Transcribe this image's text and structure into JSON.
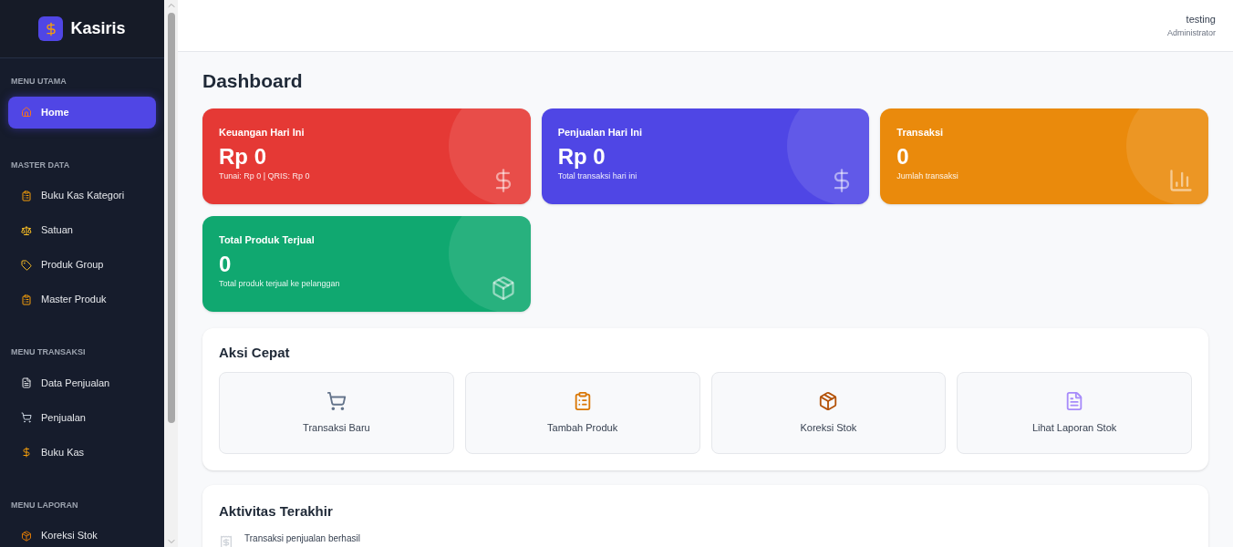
{
  "brand": {
    "name": "Kasiris"
  },
  "sidebar": {
    "sections": [
      {
        "title": "MENU UTAMA",
        "items": [
          {
            "label": "Home",
            "selected": true
          }
        ]
      },
      {
        "title": "MASTER DATA",
        "items": [
          {
            "label": "Buku Kas Kategori",
            "selected": false
          },
          {
            "label": "Satuan",
            "selected": false
          },
          {
            "label": "Produk Group",
            "selected": false
          },
          {
            "label": "Master Produk",
            "selected": false
          }
        ]
      },
      {
        "title": "MENU TRANSAKSI",
        "items": [
          {
            "label": "Data Penjualan",
            "selected": false
          },
          {
            "label": "Penjualan",
            "selected": false
          },
          {
            "label": "Buku Kas",
            "selected": false
          }
        ]
      },
      {
        "title": "MENU LAPORAN",
        "items": [
          {
            "label": "Koreksi Stok",
            "selected": false
          }
        ]
      }
    ]
  },
  "header": {
    "user_name": "testing",
    "user_role": "Administrator"
  },
  "page_title": "Dashboard",
  "stats": [
    {
      "title": "Keuangan Hari Ini",
      "value": "Rp 0",
      "caption": "Tunai: Rp 0 | QRIS: Rp 0",
      "color": "#e53935"
    },
    {
      "title": "Penjualan Hari Ini",
      "value": "Rp 0",
      "caption": "Total transaksi hari ini",
      "color": "#4f46e5"
    },
    {
      "title": "Transaksi",
      "value": "0",
      "caption": "Jumlah transaksi",
      "color": "#ea8a0c"
    },
    {
      "title": "Total Produk Terjual",
      "value": "0",
      "caption": "Total produk terjual ke pelanggan",
      "color": "#10a870"
    }
  ],
  "quick_actions": {
    "title": "Aksi Cepat",
    "items": [
      "Transaksi Baru",
      "Tambah Produk",
      "Koreksi Stok",
      "Lihat Laporan Stok"
    ]
  },
  "recent_activity": {
    "title": "Aktivitas Terakhir",
    "items": [
      "Transaksi penjualan berhasil"
    ]
  }
}
